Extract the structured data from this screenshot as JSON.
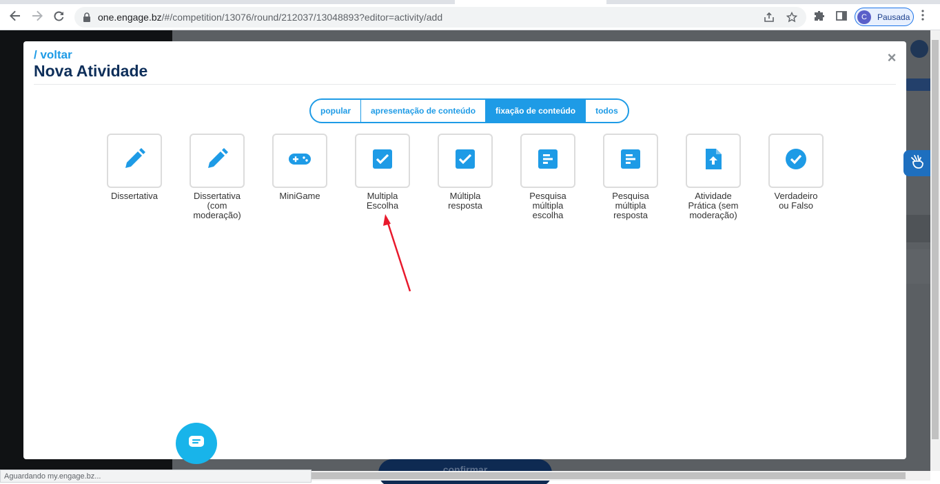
{
  "browser": {
    "url_host": "one.engage.bz",
    "url_path": "/#/competition/13076/round/212037/13048893?editor=activity/add",
    "profile_initial": "C",
    "profile_label": "Pausada"
  },
  "status_text": "Aguardando my.engage.bz...",
  "modal": {
    "back_label": "/ voltar",
    "title": "Nova Atividade",
    "close_label": "×"
  },
  "filters": [
    {
      "label": "popular",
      "active": false
    },
    {
      "label": "apresentação de conteúdo",
      "active": false
    },
    {
      "label": "fixação de conteúdo",
      "active": true
    },
    {
      "label": "todos",
      "active": false
    }
  ],
  "activities": [
    {
      "label": "Dissertativa",
      "icon": "pencil-icon"
    },
    {
      "label": "Dissertativa (com moderação)",
      "icon": "pencil-icon"
    },
    {
      "label": "MiniGame",
      "icon": "gamepad-icon"
    },
    {
      "label": "Multipla Escolha",
      "icon": "checkbox-icon"
    },
    {
      "label": "Múltipla resposta",
      "icon": "checkbox-icon"
    },
    {
      "label": "Pesquisa múltipla escolha",
      "icon": "survey-icon"
    },
    {
      "label": "Pesquisa múltipla resposta",
      "icon": "survey-icon"
    },
    {
      "label": "Atividade Prática (sem moderação)",
      "icon": "file-upload-icon"
    },
    {
      "label": "Verdadeiro ou Falso",
      "icon": "check-circle-icon"
    }
  ],
  "confirm_label": "confirmar",
  "colors": {
    "accent": "#1e9be6",
    "title": "#0e2f5a",
    "annotation_arrow": "#e8192c"
  }
}
